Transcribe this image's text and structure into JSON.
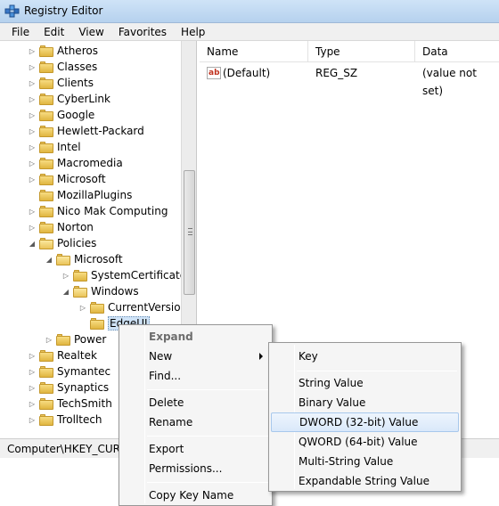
{
  "window": {
    "title": "Registry Editor"
  },
  "menubar": {
    "items": [
      "File",
      "Edit",
      "View",
      "Favorites",
      "Help"
    ]
  },
  "tree": {
    "items": [
      {
        "label": "Atheros",
        "level": 0,
        "expanded": false
      },
      {
        "label": "Classes",
        "level": 0,
        "expanded": false
      },
      {
        "label": "Clients",
        "level": 0,
        "expanded": false
      },
      {
        "label": "CyberLink",
        "level": 0,
        "expanded": false
      },
      {
        "label": "Google",
        "level": 0,
        "expanded": false
      },
      {
        "label": "Hewlett-Packard",
        "level": 0,
        "expanded": false
      },
      {
        "label": "Intel",
        "level": 0,
        "expanded": false
      },
      {
        "label": "Macromedia",
        "level": 0,
        "expanded": false
      },
      {
        "label": "Microsoft",
        "level": 0,
        "expanded": false
      },
      {
        "label": "MozillaPlugins",
        "level": 0,
        "expanded": null
      },
      {
        "label": "Nico Mak Computing",
        "level": 0,
        "expanded": false
      },
      {
        "label": "Norton",
        "level": 0,
        "expanded": false
      },
      {
        "label": "Policies",
        "level": 0,
        "expanded": true
      },
      {
        "label": "Microsoft",
        "level": 1,
        "expanded": true
      },
      {
        "label": "SystemCertificates",
        "level": 2,
        "expanded": false
      },
      {
        "label": "Windows",
        "level": 2,
        "expanded": true
      },
      {
        "label": "CurrentVersion",
        "level": 3,
        "expanded": false
      },
      {
        "label": "EdgeUI",
        "level": 3,
        "expanded": null,
        "selected": true
      },
      {
        "label": "Power",
        "level": 1,
        "expanded": false
      },
      {
        "label": "Realtek",
        "level": 0,
        "expanded": false
      },
      {
        "label": "Symantec",
        "level": 0,
        "expanded": false
      },
      {
        "label": "Synaptics",
        "level": 0,
        "expanded": false
      },
      {
        "label": "TechSmith",
        "level": 0,
        "expanded": false
      },
      {
        "label": "Trolltech",
        "level": 0,
        "expanded": false
      }
    ]
  },
  "values": {
    "columns": [
      "Name",
      "Type",
      "Data"
    ],
    "rows": [
      {
        "name": "(Default)",
        "type": "REG_SZ",
        "data": "(value not set)",
        "icon": "string-value-icon"
      }
    ]
  },
  "statusbar": {
    "path": "Computer\\HKEY_CURRENT_USER\\Software\\Policies\\Microsoft\\Windows\\EdgeUI"
  },
  "context_menu": {
    "items": [
      {
        "label": "Expand",
        "disabled": true
      },
      {
        "label": "New",
        "submenu": true,
        "highlighted": false
      },
      {
        "label": "Find..."
      },
      {
        "separator": true
      },
      {
        "label": "Delete"
      },
      {
        "label": "Rename"
      },
      {
        "separator": true
      },
      {
        "label": "Export"
      },
      {
        "label": "Permissions..."
      },
      {
        "separator": true
      },
      {
        "label": "Copy Key Name"
      }
    ]
  },
  "new_submenu": {
    "items": [
      {
        "label": "Key"
      },
      {
        "separator": true
      },
      {
        "label": "String Value"
      },
      {
        "label": "Binary Value"
      },
      {
        "label": "DWORD (32-bit) Value",
        "highlighted": true
      },
      {
        "label": "QWORD (64-bit) Value"
      },
      {
        "label": "Multi-String Value"
      },
      {
        "label": "Expandable String Value"
      }
    ]
  }
}
